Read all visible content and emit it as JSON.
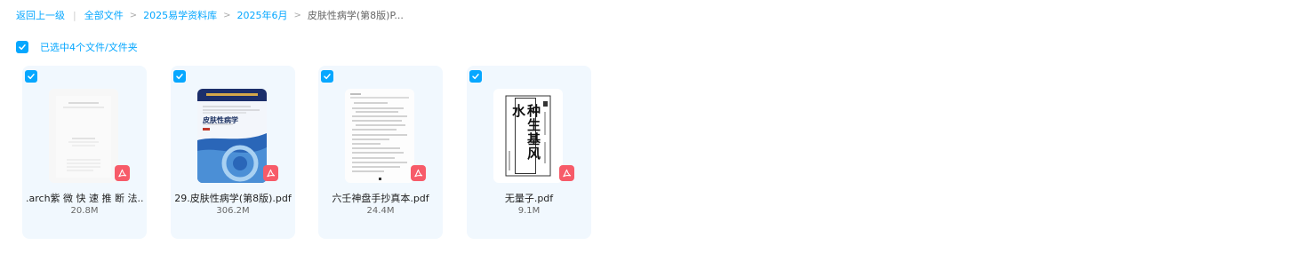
{
  "breadcrumb": {
    "back": "返回上一级",
    "items": [
      "全部文件",
      "2025易学资料库",
      "2025年6月"
    ],
    "current": "皮肤性病学(第8版)P..."
  },
  "selection": {
    "text": "已选中4个文件/文件夹",
    "accent": "#06a7ff"
  },
  "files": [
    {
      "name": ".arch紫 微 快 速 推 断 法...",
      "size": "20.8M",
      "type": "pdf"
    },
    {
      "name": "29.皮肤性病学(第8版).pdf",
      "size": "306.2M",
      "type": "pdf",
      "cover_title": "皮肤性病学"
    },
    {
      "name": "六壬神盘手抄真本.pdf",
      "size": "24.4M",
      "type": "pdf"
    },
    {
      "name": "无量子.pdf",
      "size": "9.1M",
      "type": "pdf",
      "cover_title": "种生基风水"
    }
  ],
  "colors": {
    "accent": "#06a7ff",
    "card_bg": "#f1f8fe",
    "pdf_badge": "#f75b69"
  },
  "icons": {
    "check": "check-icon",
    "pdf": "pdf-icon"
  }
}
